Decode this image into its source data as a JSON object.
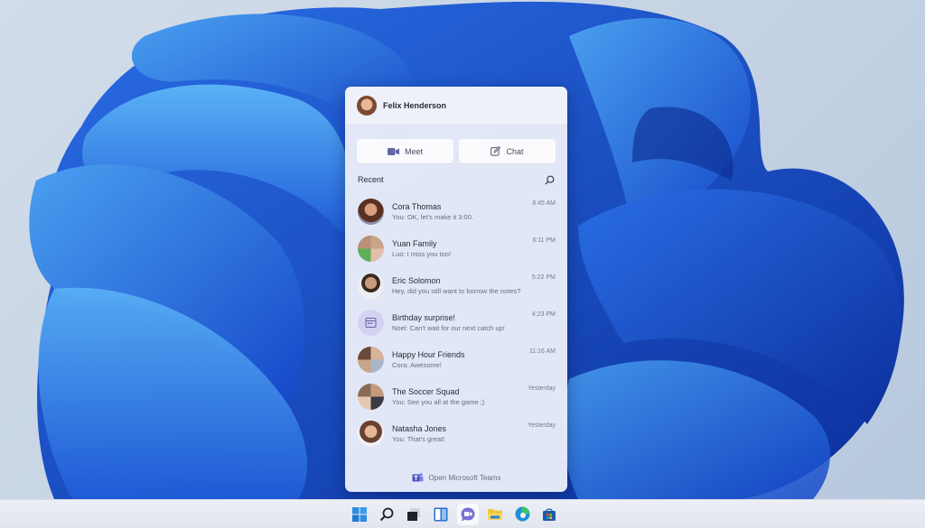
{
  "user": {
    "name": "Felix Henderson"
  },
  "actions": {
    "meet_label": "Meet",
    "chat_label": "Chat"
  },
  "recent": {
    "title": "Recent"
  },
  "chats": [
    {
      "name": "Cora Thomas",
      "message": "You: OK, let's make it 3:00.",
      "time": "8:45 AM",
      "avatar": "person"
    },
    {
      "name": "Yuan Family",
      "message": "Luo: I miss you too!",
      "time": "6:11 PM",
      "avatar": "group"
    },
    {
      "name": "Eric Solomon",
      "message": "Hey, did you still want to borrow the notes?",
      "time": "5:22 PM",
      "avatar": "person"
    },
    {
      "name": "Birthday surprise!",
      "message": "Noel: Can't wait for our next catch up!",
      "time": "4:23 PM",
      "avatar": "calendar-icon"
    },
    {
      "name": "Happy Hour Friends",
      "message": "Cora: Awesome!",
      "time": "11:16 AM",
      "avatar": "group"
    },
    {
      "name": "The Soccer Squad",
      "message": "You: See you all at the game ;)",
      "time": "Yesterday",
      "avatar": "group"
    },
    {
      "name": "Natasha Jones",
      "message": "You: That's great!",
      "time": "Yesterday",
      "avatar": "person"
    }
  ],
  "footer": {
    "label": "Open Microsoft Teams"
  },
  "taskbar": {
    "icons": [
      "start-icon",
      "search-icon",
      "task-view-icon",
      "widgets-icon",
      "teams-chat-icon",
      "file-explorer-icon",
      "edge-icon",
      "store-icon"
    ]
  },
  "colors": {
    "accent": "#6264a7",
    "wallpaper_blue": "#1a56d6"
  }
}
